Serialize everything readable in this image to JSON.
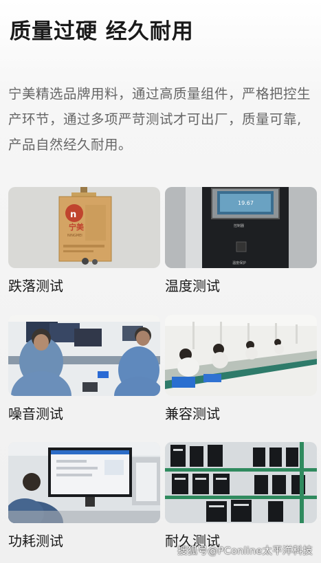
{
  "header": {
    "title": "质量过硬 经久耐用"
  },
  "intro": {
    "text": "宁美精选品牌用料，通过高质量组件，严格把控生产环节，通过多项严苛测试才可出厂，质量可靠,产品自然经久耐用。"
  },
  "tests": [
    {
      "label": "跌落测试",
      "icon": "drop-test-photo"
    },
    {
      "label": "温度测试",
      "icon": "temperature-test-photo"
    },
    {
      "label": "噪音测试",
      "icon": "noise-test-photo"
    },
    {
      "label": "兼容测试",
      "icon": "compatibility-test-photo"
    },
    {
      "label": "功耗测试",
      "icon": "power-test-photo"
    },
    {
      "label": "耐久测试",
      "icon": "durability-test-photo"
    }
  ],
  "photo_text": {
    "box_brand": "宁美",
    "box_brand_en": "NINGMEI",
    "chamber_display": "19.67",
    "chamber_panel": "控制器",
    "chamber_door": "温度保护"
  },
  "watermark": {
    "text": "搜狐号@PConline太平洋科技"
  }
}
